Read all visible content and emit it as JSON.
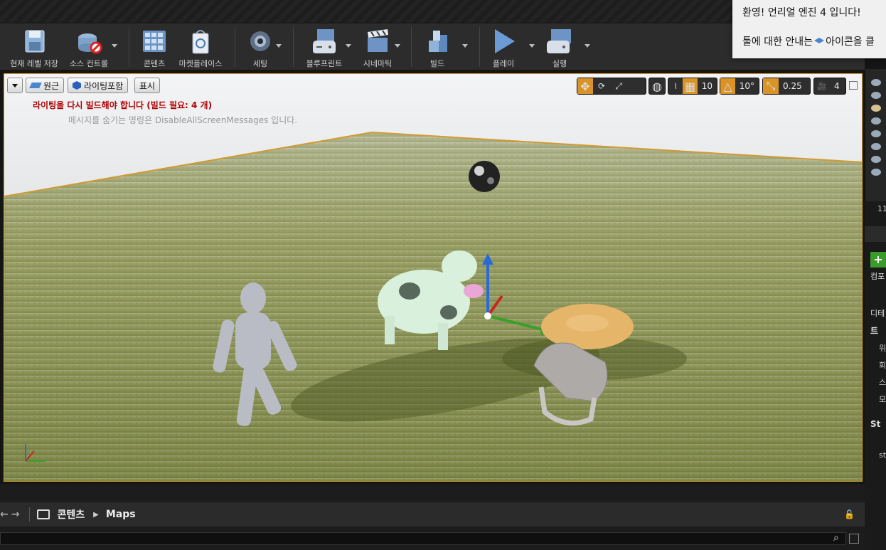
{
  "toolbar": {
    "save": "현재 레벨 저장",
    "source_control": "소스 컨트롤",
    "content": "콘텐츠",
    "marketplace": "마켓플레이스",
    "settings": "세팅",
    "blueprints": "블루프린트",
    "cinematics": "시네마틱",
    "build": "빌드",
    "play": "플레이",
    "launch": "실행"
  },
  "viewport": {
    "perspective": "원근",
    "lit": "라이팅포함",
    "show": "표시",
    "grid_snap": "10",
    "rotation_snap": "10°",
    "scale_snap": "0.25",
    "camera_speed": "4",
    "warning": "라이팅을 다시 빌드해야 합니다 (빌드 필요: 4 개)",
    "hint": "메시지를 숨기는 명령은 DisableAllScreenMessages 입니다."
  },
  "toast": {
    "line1": "환영! 언리얼 엔진 4 입니다!",
    "line2_a": "툴에 대한 안내는",
    "line2_b": "아이콘을 클"
  },
  "breadcrumb": {
    "root": "콘텐츠",
    "folder": "Maps"
  },
  "rightpanel": {
    "count": "11",
    "labels": [
      "컴포",
      "디테",
      "트",
      "위",
      "회",
      "스",
      "모",
      "St",
      "st"
    ]
  },
  "colors": {
    "accent": "#d99326",
    "warning": "#b00000",
    "viewport_border": "#d4a020"
  }
}
